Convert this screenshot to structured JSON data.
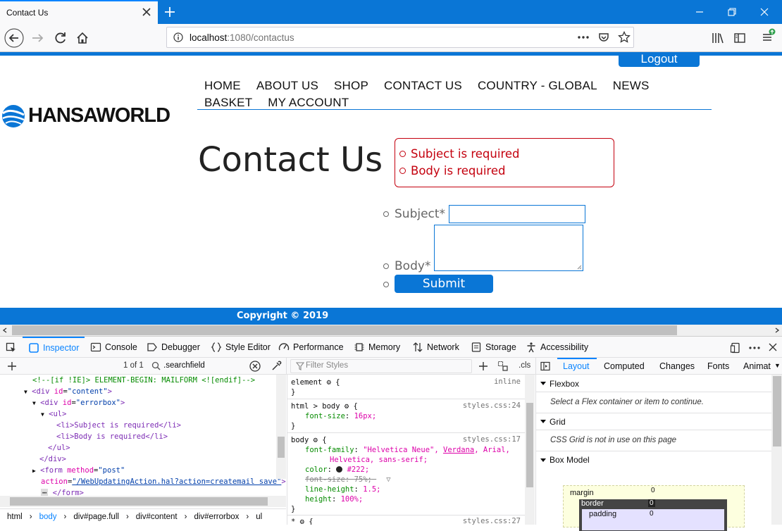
{
  "browser": {
    "tab_title": "Contact Us",
    "url_host": "localhost",
    "url_path": ":1080/contactus"
  },
  "site": {
    "logout_label": "Logout",
    "logo_text": "HANSAWORLD",
    "nav_row1": [
      "HOME",
      "ABOUT US",
      "SHOP",
      "CONTACT US",
      "COUNTRY - GLOBAL",
      "NEWS"
    ],
    "nav_row2": [
      "BASKET",
      "MY ACCOUNT"
    ],
    "heading": "Contact Us",
    "errors": [
      "Subject is required",
      "Body is required"
    ],
    "subject_label": "Subject*",
    "body_label": "Body*",
    "submit_label": "Submit",
    "footer_text": "Copyright © 2019"
  },
  "devtools": {
    "tabs": [
      "Inspector",
      "Console",
      "Debugger",
      "Style Editor",
      "Performance",
      "Memory",
      "Network",
      "Storage",
      "Accessibility"
    ],
    "search_count": "1 of 1",
    "search_value": ".searchfield",
    "filter_placeholder": "Filter Styles",
    "cls_label": ".cls",
    "markup": [
      "<!--[if !IE]> ELEMENT-BEGIN: MAILFORM <![endif]-->",
      "<div id=\"content\">",
      "<div id=\"errorbox\">",
      "<ul>",
      "<li>Subject is required</li>",
      "<li>Body is required</li>",
      "</ul>",
      "</div>",
      "<form method=\"post\"",
      "action=\"/WebUpdatingAction.hal?action=createmail save\">",
      "</form>"
    ],
    "breadcrumbs": [
      "html",
      "body",
      "div#page.full",
      "div#content",
      "div#errorbox",
      "ul"
    ],
    "rules": {
      "element_selector": "element",
      "element_source": "inline",
      "rule1_selector": "html > body",
      "rule1_source": "styles.css:24",
      "rule1_prop": "font-size",
      "rule1_val": "16px;",
      "rule2_selector": "body",
      "rule2_source": "styles.css:17",
      "rule2_font_family_prop": "font-family",
      "rule2_font_family_val1": "\"Helvetica Neue\",",
      "rule2_font_family_val2": "Verdana",
      "rule2_font_family_val3": ", Arial,",
      "rule2_font_family_val4": "Helvetica, sans-serif;",
      "rule2_color_prop": "color",
      "rule2_color_val": "#222;",
      "rule2_fontsize_prop": "font-size",
      "rule2_fontsize_val": "75%;",
      "rule2_lh_prop": "line-height",
      "rule2_lh_val": "1.5;",
      "rule2_height_prop": "height",
      "rule2_height_val": "100%;",
      "rule3_selector": "*",
      "rule3_source": "styles.css:27"
    },
    "layout_tabs": [
      "Layout",
      "Computed",
      "Changes",
      "Fonts",
      "Animat"
    ],
    "flexbox_title": "Flexbox",
    "flexbox_note": "Select a Flex container or item to continue.",
    "grid_title": "Grid",
    "grid_note": "CSS Grid is not in use on this page",
    "boxmodel_title": "Box Model",
    "box_margin_label": "margin",
    "box_margin_val": "0",
    "box_border_label": "border",
    "box_border_val": "0",
    "box_padding_label": "padding",
    "box_padding_val": "0"
  },
  "colors": {
    "brand_blue": "#0a76d6",
    "error_red": "#c4000e"
  }
}
